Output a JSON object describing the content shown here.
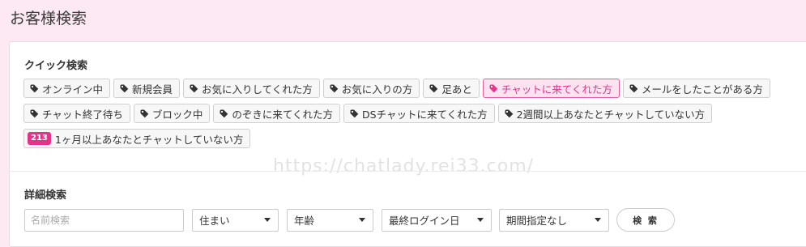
{
  "page": {
    "title": "お客様検索"
  },
  "quick_search": {
    "title": "クイック検索",
    "chips": [
      {
        "label": "オンライン中",
        "active": false
      },
      {
        "label": "新規会員",
        "active": false
      },
      {
        "label": "お気に入りしてくれた方",
        "active": false
      },
      {
        "label": "お気に入りの方",
        "active": false
      },
      {
        "label": "足あと",
        "active": false
      },
      {
        "label": "チャットに来てくれた方",
        "active": true
      },
      {
        "label": "メールをしたことがある方",
        "active": false
      },
      {
        "label": "チャット終了待ち",
        "active": false
      },
      {
        "label": "ブロック中",
        "active": false
      },
      {
        "label": "のぞきに来てくれた方",
        "active": false
      },
      {
        "label": "DSチャットに来てくれた方",
        "active": false
      },
      {
        "label": "2週間以上あなたとチャットしていない方",
        "active": false
      }
    ],
    "badge_chip": {
      "badge": "213",
      "label": "1ヶ月以上あなたとチャットしていない方"
    }
  },
  "detail_search": {
    "title": "詳細検索",
    "name_placeholder": "名前検索",
    "selects": [
      "住まい",
      "年齢",
      "最終ログイン日",
      "期間指定なし"
    ],
    "search_label": "検 索"
  },
  "watermark": "https://chatlady.rei33.com/",
  "colors": {
    "background": "#fde9f3",
    "accent": "#e3358a",
    "badge": "#e6338a"
  },
  "icons": {
    "chip": "tag-icon",
    "select": "caret-down-icon"
  }
}
